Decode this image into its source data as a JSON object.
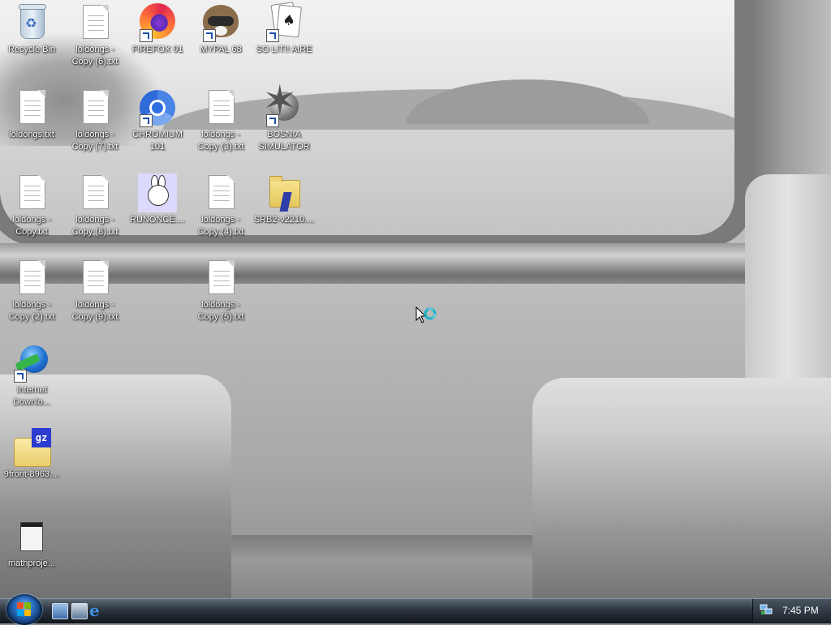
{
  "desktop": {
    "icons": [
      {
        "label": "Recycle Bin",
        "icon": "recycle-bin-icon"
      },
      {
        "label": "loldongs -\nCopy (6).txt",
        "icon": "text-file-icon"
      },
      {
        "label": "FIREFOX 91",
        "icon": "firefox-icon"
      },
      {
        "label": "MYPAL 68",
        "icon": "mypal-icon"
      },
      {
        "label": "SO LIT!! AIRE",
        "icon": "solitaire-icon"
      },
      {
        "label": "loldongs.txt",
        "icon": "text-file-icon"
      },
      {
        "label": "loldongs -\nCopy (7).txt",
        "icon": "text-file-icon"
      },
      {
        "label": "CHROMIUM\n101",
        "icon": "chromium-icon"
      },
      {
        "label": "loldongs -\nCopy (3).txt",
        "icon": "text-file-icon"
      },
      {
        "label": "BOSNIA\nSIMULATOR",
        "icon": "mine-icon"
      },
      {
        "label": "loldongs -\nCopy.txt",
        "icon": "text-file-icon"
      },
      {
        "label": "loldongs -\nCopy (8).txt",
        "icon": "text-file-icon"
      },
      {
        "label": "RUNONCE....",
        "icon": "rabbit-icon"
      },
      {
        "label": "loldongs -\nCopy (4).txt",
        "icon": "text-file-icon"
      },
      {
        "label": "SRB2-v2210....",
        "icon": "folder-icon"
      },
      {
        "label": "loldongs -\nCopy (2).txt",
        "icon": "text-file-icon"
      },
      {
        "label": "loldongs -\nCopy (9).txt",
        "icon": "text-file-icon"
      },
      {
        "label": "loldongs -\nCopy (5).txt",
        "icon": "text-file-icon"
      },
      {
        "label": "Internet\nDownlo...",
        "icon": "internet-download-manager-icon"
      },
      {
        "label": "9front-8963....",
        "icon": "gz-archive-icon",
        "badge": "gz"
      },
      {
        "label": "mathproje...",
        "icon": "application-icon"
      }
    ]
  },
  "taskbar": {
    "start_button": "start-orb-icon",
    "quick_launch": [
      {
        "name": "show-desktop-icon"
      },
      {
        "name": "switch-windows-icon"
      },
      {
        "name": "internet-explorer-icon",
        "glyph": "e"
      }
    ],
    "tray": {
      "clock": "7:45 PM",
      "network": "network-icon"
    }
  },
  "colors": {
    "icon_label": "#ffffff",
    "taskbar_top": "#5e6a76",
    "taskbar_bottom": "#11161c",
    "start_orb": "#2a6fc4",
    "windows_flag": [
      "#f25022",
      "#7fba00",
      "#00a4ef",
      "#ffb900"
    ]
  }
}
